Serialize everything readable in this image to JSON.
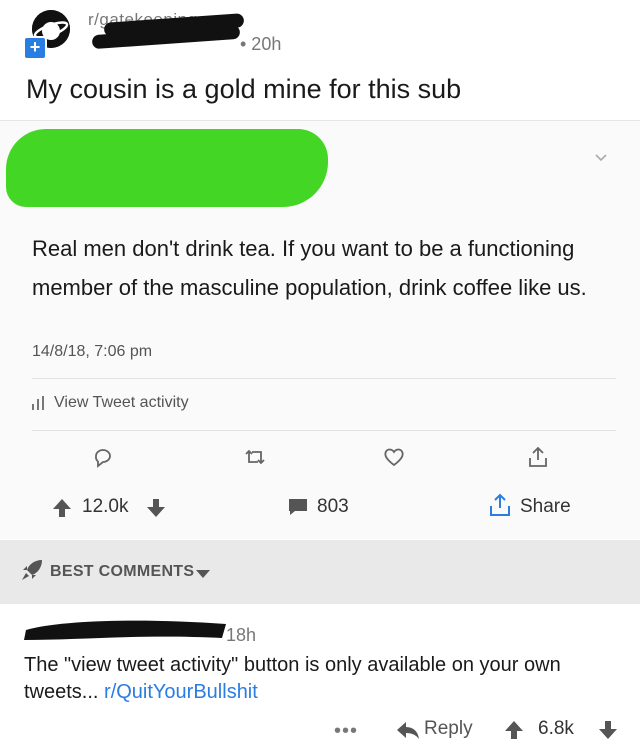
{
  "post": {
    "subreddit": "r/gatekeeping",
    "time": "• 20h",
    "title": "My cousin is a gold mine for this sub"
  },
  "tweet": {
    "text": "Real men don't drink tea. If you want to be a functioning member of the masculine population, drink coffee like us.",
    "date": "14/8/18, 7:06 pm",
    "activity_label": "View Tweet activity",
    "icons": [
      "reply-icon",
      "retweet-icon",
      "like-icon",
      "share-icon"
    ]
  },
  "votes": {
    "score": "12.0k",
    "comments": "803",
    "share_label": "Share"
  },
  "comments_header": {
    "label": "BEST COMMENTS"
  },
  "comment": {
    "time": "18h",
    "text": "The \"view tweet activity\" button is only available on your own tweets... ",
    "link": "r/QuitYourBullshit",
    "more": "•••",
    "reply_label": "Reply",
    "score": "6.8k"
  },
  "colors": {
    "accent": "#2a7de1",
    "redaction_green": "#44d625",
    "comments_bar": "#e9e9e9"
  }
}
